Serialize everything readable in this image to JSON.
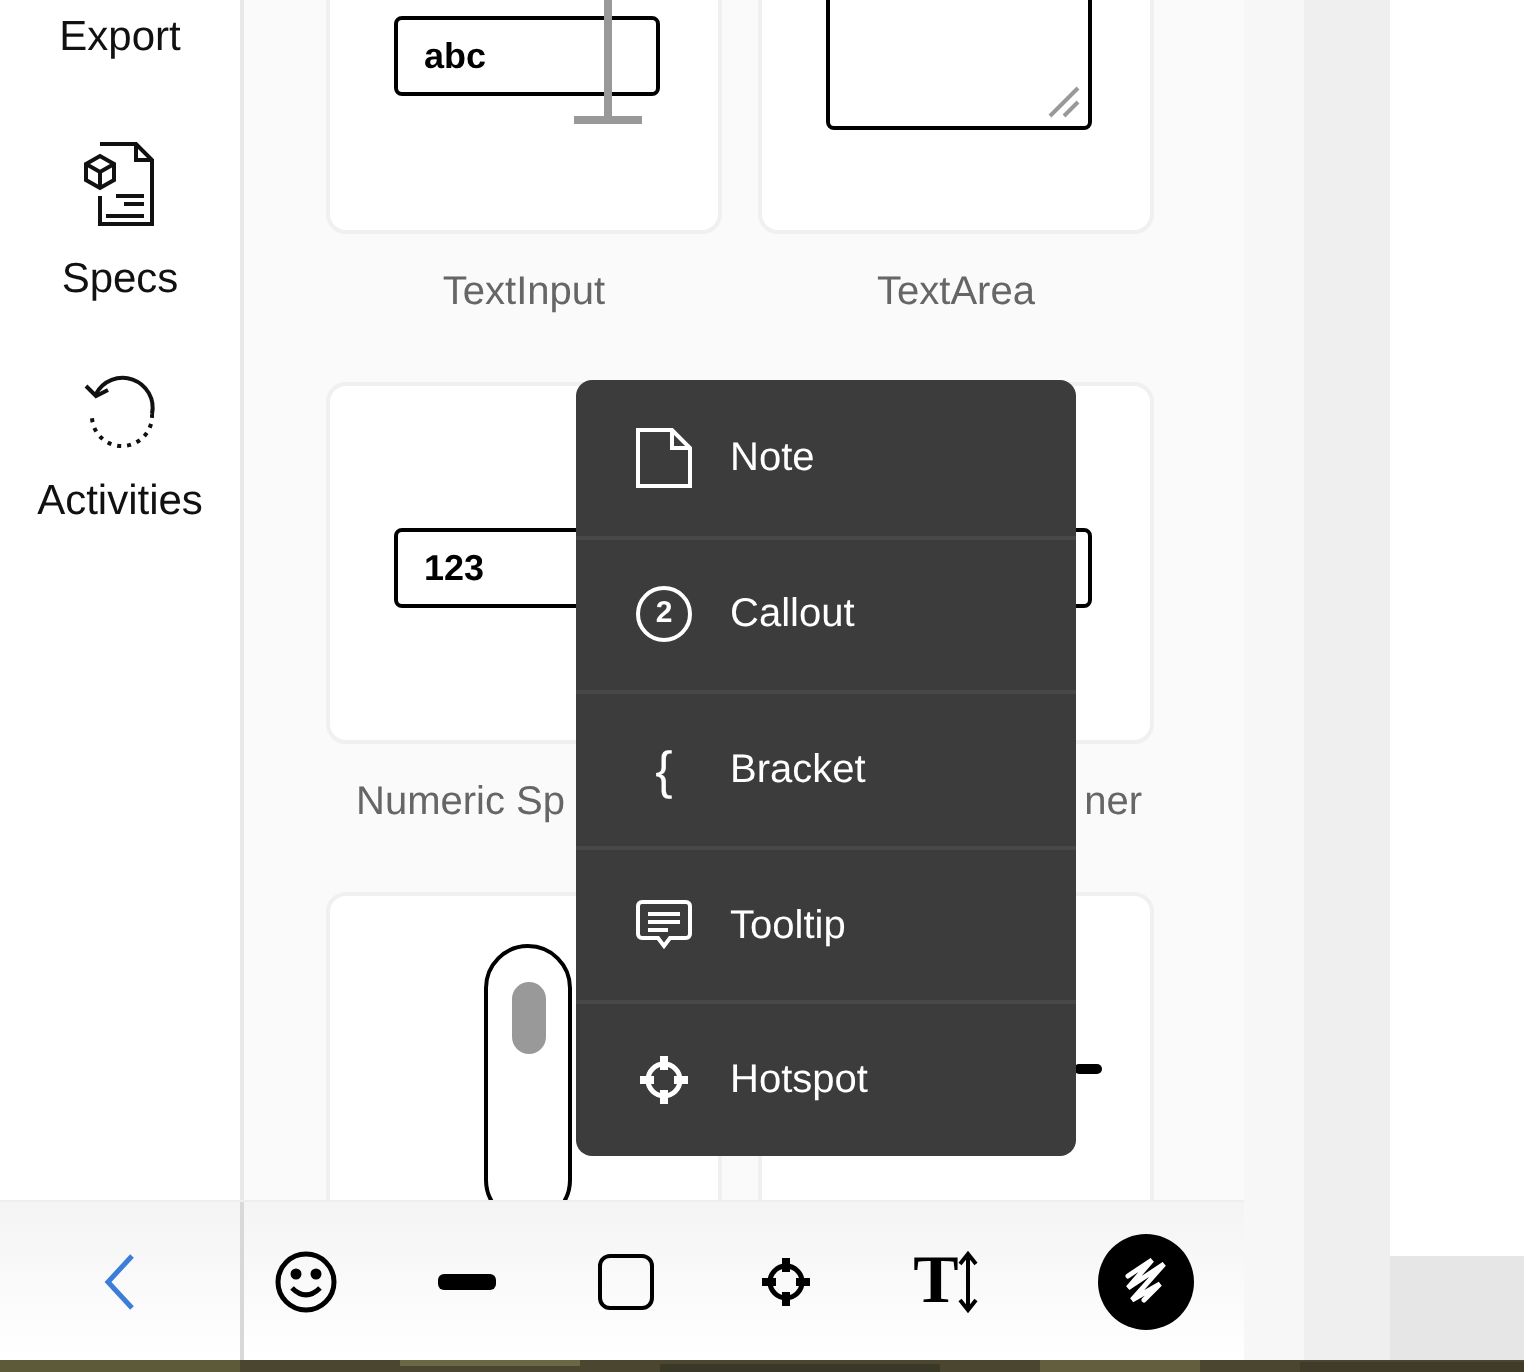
{
  "sidebar": {
    "items": [
      {
        "label": "Export"
      },
      {
        "label": "Specs"
      },
      {
        "label": "Activities"
      }
    ]
  },
  "components": [
    {
      "kind": "text-input",
      "label": "TextInput",
      "sample": "abc"
    },
    {
      "kind": "text-area",
      "label": "TextArea"
    },
    {
      "kind": "numeric",
      "label": "Numeric Sp",
      "sample": "123"
    },
    {
      "kind": "spinner",
      "label": "ner"
    },
    {
      "kind": "scroll"
    },
    {
      "kind": "dash"
    }
  ],
  "menu": {
    "items": [
      {
        "kind": "note",
        "label": "Note"
      },
      {
        "kind": "callout",
        "label": "Callout",
        "badge": "2"
      },
      {
        "kind": "bracket",
        "label": "Bracket",
        "glyph": "{"
      },
      {
        "kind": "tooltip",
        "label": "Tooltip"
      },
      {
        "kind": "hotspot",
        "label": "Hotspot"
      }
    ]
  },
  "toolbar": {
    "tools": [
      {
        "kind": "emoji",
        "selected": false
      },
      {
        "kind": "line",
        "selected": false
      },
      {
        "kind": "rect",
        "selected": false
      },
      {
        "kind": "hotspot",
        "selected": false
      },
      {
        "kind": "text",
        "glyph": "T",
        "selected": false
      },
      {
        "kind": "scribble",
        "selected": true
      }
    ]
  }
}
